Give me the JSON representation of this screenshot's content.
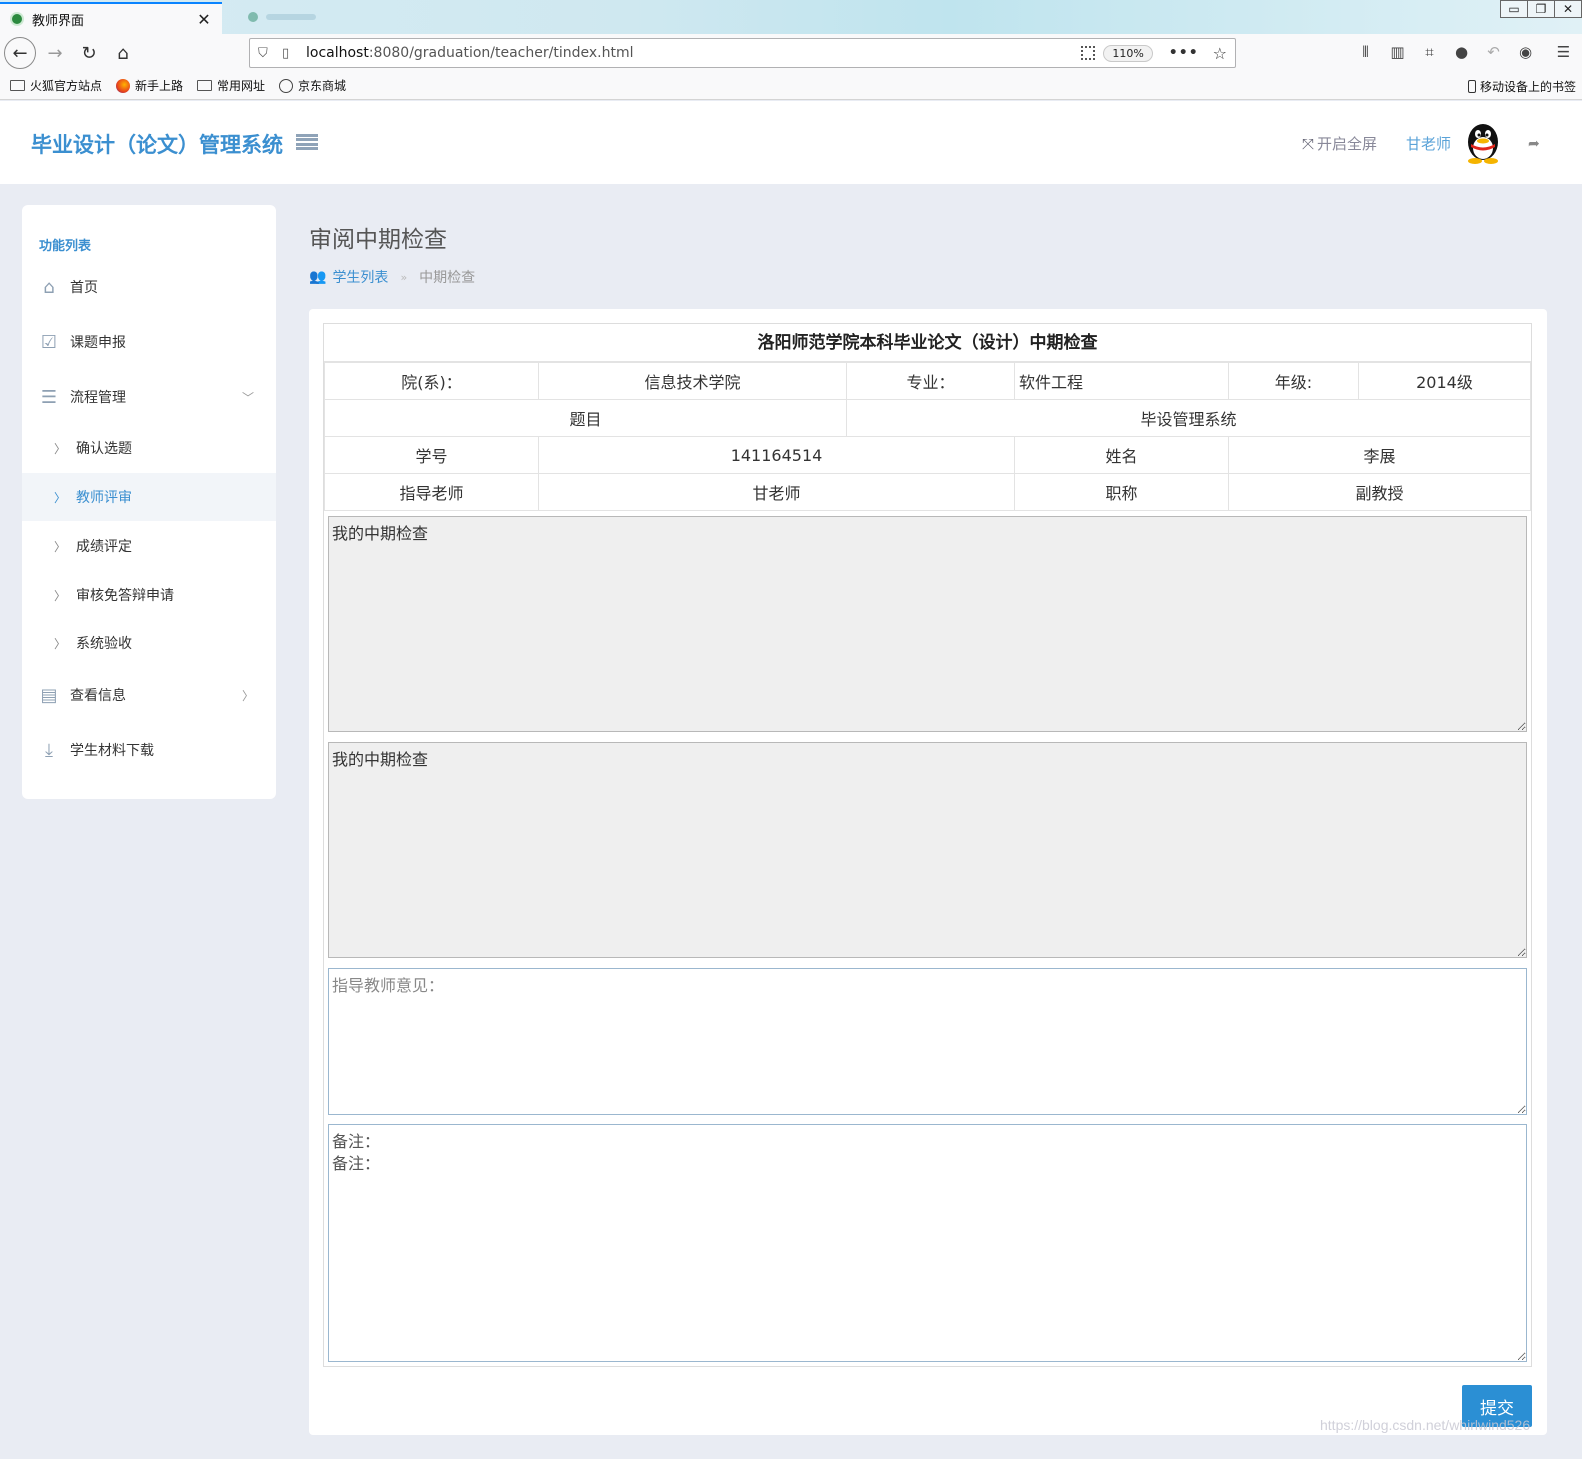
{
  "browser": {
    "tab_title": "教师界面",
    "url_host": "localhost",
    "url_path": ":8080/graduation/teacher/tindex.html",
    "zoom": "110%",
    "bookmarks": [
      "火狐官方站点",
      "新手上路",
      "常用网址",
      "京东商城"
    ],
    "bookmarks_right": "移动设备上的书签"
  },
  "header": {
    "brand": "毕业设计（论文）管理系统",
    "fullscreen": "开启全屏",
    "user": "甘老师"
  },
  "sidebar": {
    "title": "功能列表",
    "items": [
      {
        "label": "首页"
      },
      {
        "label": "课题申报"
      },
      {
        "label": "流程管理"
      },
      {
        "label": "查看信息"
      },
      {
        "label": "学生材料下载"
      }
    ],
    "sub_items": [
      {
        "label": "确认选题"
      },
      {
        "label": "教师评审"
      },
      {
        "label": "成绩评定"
      },
      {
        "label": "审核免答辩申请"
      },
      {
        "label": "系统验收"
      }
    ]
  },
  "main": {
    "page_title": "审阅中期检查",
    "breadcrumb": {
      "parent": "学生列表",
      "current": "中期检查"
    },
    "form_title": "洛阳师范学院本科毕业论文（设计）中期检查",
    "table": {
      "dept_label": "院(系)：",
      "dept_value": "信息技术学院",
      "major_label": "专业：",
      "major_value": "软件工程",
      "grade_label": "年级:",
      "grade_value": "2014级",
      "topic_label": "题目",
      "topic_value": "毕设管理系统",
      "sid_label": "学号",
      "sid_value": "141164514",
      "name_label": "姓名",
      "name_value": "李展",
      "advisor_label": "指导老师",
      "advisor_value": "甘老师",
      "title_label": "职称",
      "title_value": "副教授"
    },
    "textareas": {
      "check1": "我的中期检查",
      "check2": "我的中期检查",
      "opinion_placeholder": "指导教师意见：",
      "remark_value": "备注：\n备注："
    },
    "submit": "提交"
  },
  "watermark": "https://blog.csdn.net/whirlwind526",
  "colors": {
    "accent": "#3b8fd0",
    "button": "#2b8fd4",
    "background": "#e9ecf3"
  }
}
